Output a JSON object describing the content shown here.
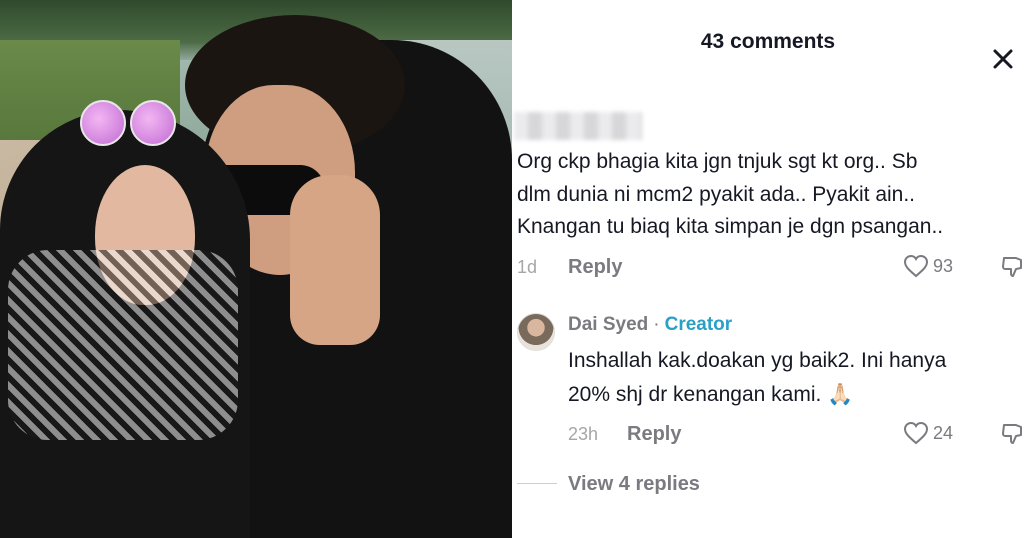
{
  "header": {
    "title": "43 comments",
    "close_icon": "close-icon"
  },
  "comments": [
    {
      "username": "",
      "lines": [
        "Org ckp bhagia kita jgn tnjuk sgt kt org.. Sb",
        "dlm dunia ni mcm2 pyakit ada.. Pyakit ain..",
        "Knangan tu biaq kita simpan je dgn psangan.."
      ],
      "time": "1d",
      "reply_label": "Reply",
      "likes": "93"
    },
    {
      "username": "Dai Syed",
      "separator": "·",
      "badge": "Creator",
      "lines": [
        "Inshallah kak.doakan yg baik2. Ini hanya",
        "20% shj dr kenangan kami. 🙏🏻"
      ],
      "time": "23h",
      "reply_label": "Reply",
      "likes": "24"
    }
  ],
  "view_replies": "View 4 replies",
  "colors": {
    "text": "#161823",
    "muted": "#7a7a80",
    "creator": "#2aa0c8"
  }
}
